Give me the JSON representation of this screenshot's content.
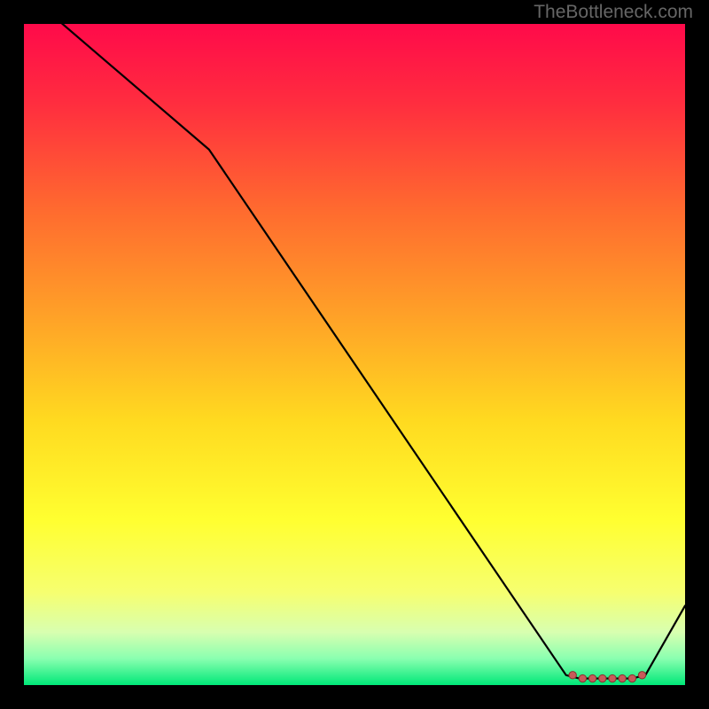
{
  "attribution": "TheBottleneck.com",
  "chart_data": {
    "type": "line",
    "title": "",
    "xlabel": "",
    "ylabel": "",
    "xlim": [
      0,
      100
    ],
    "ylim": [
      0,
      100
    ],
    "series": [
      {
        "name": "main-curve",
        "x": [
          0,
          28,
          82,
          84,
          86,
          88,
          90,
          92,
          94,
          100
        ],
        "values": [
          105,
          81,
          1.5,
          1,
          1,
          1,
          1,
          1,
          1.5,
          12
        ]
      }
    ],
    "markers": {
      "name": "bottom-markers",
      "x": [
        83,
        84.5,
        86,
        87.5,
        89,
        90.5,
        92,
        93.5
      ],
      "values": [
        1.5,
        1,
        1,
        1,
        1,
        1,
        1,
        1.5
      ]
    },
    "gradient_stops": [
      {
        "offset": 0,
        "color": "#ff0a4a"
      },
      {
        "offset": 0.12,
        "color": "#ff2d3f"
      },
      {
        "offset": 0.28,
        "color": "#ff6a2f"
      },
      {
        "offset": 0.45,
        "color": "#ffa427"
      },
      {
        "offset": 0.6,
        "color": "#ffda20"
      },
      {
        "offset": 0.75,
        "color": "#ffff30"
      },
      {
        "offset": 0.86,
        "color": "#f6ff70"
      },
      {
        "offset": 0.92,
        "color": "#d8ffb0"
      },
      {
        "offset": 0.96,
        "color": "#8affb0"
      },
      {
        "offset": 1.0,
        "color": "#00e878"
      }
    ]
  }
}
